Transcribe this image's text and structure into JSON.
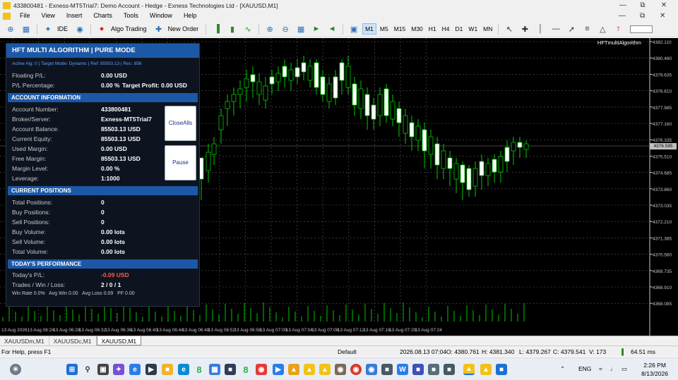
{
  "window": {
    "title": "433800481 - Exness-MT5Trial7: Demo Account - Hedge - Exness Technologies Ltd - [XAUUSD,M1]"
  },
  "menu": [
    "File",
    "View",
    "Insert",
    "Charts",
    "Tools",
    "Window",
    "Help"
  ],
  "toolbar": {
    "ide_label": "IDE",
    "algo_label": "Algo Trading",
    "order_label": "New Order",
    "timeframes": [
      "M1",
      "M5",
      "M15",
      "M30",
      "H1",
      "H4",
      "D1",
      "W1",
      "MN"
    ],
    "active_timeframe": "M1",
    "notify_count": "7"
  },
  "chart": {
    "indicator_label": "HFTmultiAlgorithm",
    "current_price": "4376.595",
    "price_labels": [
      "4382.110",
      "4380.460",
      "4379.635",
      "4378.810",
      "4377.985",
      "4377.160",
      "4376.335",
      "4375.510",
      "4374.685",
      "4373.860",
      "4373.035",
      "4372.210",
      "4371.385",
      "4370.560",
      "4369.735",
      "4368.910",
      "4368.085"
    ],
    "time_labels": [
      "13 Aug 2026",
      "13 Aug 06:24",
      "13 Aug 06:28",
      "13 Aug 06:32",
      "13 Aug 06:36",
      "13 Aug 06:40",
      "13 Aug 06:44",
      "13 Aug 06:48",
      "13 Aug 06:52",
      "13 Aug 06:56",
      "13 Aug 07:00",
      "13 Aug 07:04",
      "13 Aug 07:08",
      "13 Aug 07:12",
      "13 Aug 07:16",
      "13 Aug 07:20",
      "13 Aug 07:24"
    ]
  },
  "panel": {
    "title": "HFT MULTI ALGORITHM | PURE MODE",
    "subinfo": "Active Alg: 0 | Target Mode: Dynamic | Ref: 85503.13 | Rec: 856",
    "floating_pl_label": "Floating P/L:",
    "floating_pl": "0.00 USD",
    "pl_pct_label": "P/L Percentage:",
    "pl_pct": "0.00 %",
    "target_profit": "Target Profit: 0.00 USD",
    "account_section": "ACCOUNT INFORMATION",
    "account_rows": [
      {
        "label": "Account Number:",
        "value": "433800481"
      },
      {
        "label": "Broker/Server:",
        "value": "Exness-MT5Trial7"
      },
      {
        "label": "Account Balance:",
        "value": "85503.13 USD"
      },
      {
        "label": "Current Equity:",
        "value": "85503.13 USD"
      },
      {
        "label": "Used Margin:",
        "value": "0.00 USD"
      },
      {
        "label": "Free Margin:",
        "value": "85503.13 USD"
      },
      {
        "label": "Margin Level:",
        "value": "0.00 %"
      },
      {
        "label": "Leverage:",
        "value": "1:1000"
      }
    ],
    "close_all_label": "CloseAlls",
    "pause_label": "Pause",
    "positions_section": "CURRENT POSITIONS",
    "position_rows": [
      {
        "label": "Total Positions:",
        "value": "0"
      },
      {
        "label": "Buy Positions:",
        "value": "0"
      },
      {
        "label": "Sell Positions:",
        "value": "0"
      },
      {
        "label": "Buy Volume:",
        "value": "0.00 lots"
      },
      {
        "label": "Sell Volume:",
        "value": "0.00 lots"
      },
      {
        "label": "Total Volume:",
        "value": "0.00 lots"
      }
    ],
    "performance_section": "TODAY'S PERFORMANCE",
    "todays_pl_label": "Today's P/L:",
    "todays_pl": "-0.09 USD",
    "trades_label": "Trades / Win / Loss:",
    "trades": "2 / 0 / 1",
    "stats_line": "Win Rate 0.0%   Avg Win 0.00   Avg Loss 0.09   PF 0.00"
  },
  "tabs": [
    "XAUUSDm,M1",
    "XAUUSDc,M1",
    "XAUUSD,M1"
  ],
  "active_tab": "XAUUSD,M1",
  "status": {
    "help": "For Help, press F1",
    "profile": "Default",
    "datetime": "2026.08.13 07:04",
    "open": "O: 4380.761",
    "high": "H: 4381.340",
    "low": "L: 4379.267",
    "close": "C: 4379.541",
    "volume": "V: 173",
    "ping": "64.51 ms"
  },
  "taskbar": {
    "lang": "ENG",
    "time": "2:26 PM",
    "date": "8/13/2026"
  }
}
